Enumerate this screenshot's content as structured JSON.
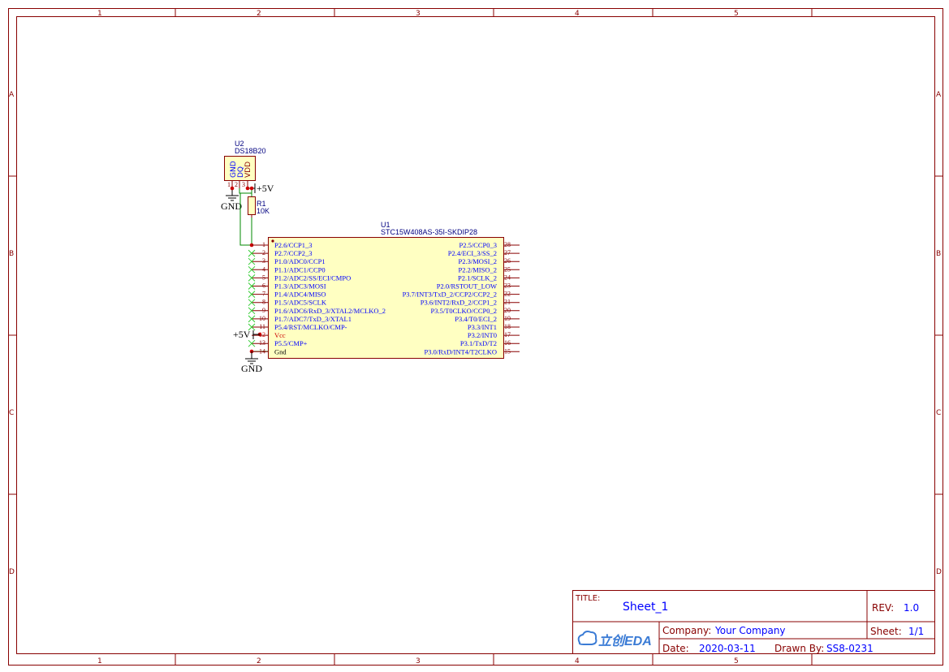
{
  "colors": {
    "frame": "#880000",
    "wire": "#008800",
    "pin_name": "#0000ff",
    "pin_number": "#880000",
    "part_label": "#000080",
    "net_label": "#000000",
    "junction": "#cc0000",
    "noconnect": "#33cc33",
    "power_pin": "#cc0000"
  },
  "frame": {
    "columns": [
      "1",
      "2",
      "3",
      "4",
      "5"
    ],
    "rows": [
      "A",
      "B",
      "C",
      "D"
    ]
  },
  "u2": {
    "designator": "U2",
    "part": "DS18B20",
    "pins": [
      {
        "name": "GND",
        "number": "1"
      },
      {
        "name": "DQ",
        "number": "2"
      },
      {
        "name": "VDD",
        "number": "3"
      }
    ]
  },
  "r1": {
    "designator": "R1",
    "value": "10K"
  },
  "net_labels": {
    "vcc_top": "+5V",
    "gnd_top": "GND",
    "vcc_mcu": "+5V",
    "gnd_mcu": "GND"
  },
  "u1": {
    "designator": "U1",
    "part": "STC15W408AS-35I-SKDIP28",
    "left_pins": [
      {
        "number": "1",
        "name": "P2.6/CCP1_3"
      },
      {
        "number": "2",
        "name": "P2.7/CCP2_3"
      },
      {
        "number": "3",
        "name": "P1.0/ADC0/CCP1"
      },
      {
        "number": "4",
        "name": "P1.1/ADC1/CCP0"
      },
      {
        "number": "5",
        "name": "P1.2/ADC2/SS/ECI/CMPO"
      },
      {
        "number": "6",
        "name": "P1.3/ADC3/MOSI"
      },
      {
        "number": "7",
        "name": "P1.4/ADC4/MISO"
      },
      {
        "number": "8",
        "name": "P1.5/ADC5/SCLK"
      },
      {
        "number": "9",
        "name": "P1.6/ADC6/RxD_3/XTAL2/MCLKO_2"
      },
      {
        "number": "10",
        "name": "P1.7/ADC7/TxD_3/XTAL1"
      },
      {
        "number": "11",
        "name": "P5.4/RST/MCLKO/CMP-"
      },
      {
        "number": "12",
        "name": "Vcc"
      },
      {
        "number": "13",
        "name": "P5.5/CMP+"
      },
      {
        "number": "14",
        "name": "Gnd"
      }
    ],
    "right_pins": [
      {
        "number": "28",
        "name": "P2.5/CCP0_3"
      },
      {
        "number": "27",
        "name": "P2.4/ECI_3/SS_2"
      },
      {
        "number": "26",
        "name": "P2.3/MOSI_2"
      },
      {
        "number": "25",
        "name": "P2.2/MISO_2"
      },
      {
        "number": "24",
        "name": "P2.1/SCLK_2"
      },
      {
        "number": "23",
        "name": "P2.0/RSTOUT_LOW"
      },
      {
        "number": "22",
        "name": "P3.7/INT3/TxD_2/CCP2/CCP2_2"
      },
      {
        "number": "21",
        "name": "P3.6/INT2/RxD_2/CCP1_2"
      },
      {
        "number": "20",
        "name": "P3.5/T0CLKO/CCP0_2"
      },
      {
        "number": "19",
        "name": "P3.4/T0/ECI_2"
      },
      {
        "number": "18",
        "name": "P3.3/INT1"
      },
      {
        "number": "17",
        "name": "P3.2/INT0"
      },
      {
        "number": "16",
        "name": "P3.1/TxD/T2"
      },
      {
        "number": "15",
        "name": "P3.0/RxD/INT4/T2CLKO"
      }
    ]
  },
  "title_block": {
    "title_label": "TITLE:",
    "title": "Sheet_1",
    "rev_label": "REV:",
    "rev": "1.0",
    "company_label": "Company:",
    "company": "Your Company",
    "sheet_label": "Sheet:",
    "sheet": "1/1",
    "date_label": "Date:",
    "date": "2020-03-11",
    "drawn_label": "Drawn By:",
    "drawn_by": "SS8-0231",
    "logo_text": "立创EDA"
  }
}
